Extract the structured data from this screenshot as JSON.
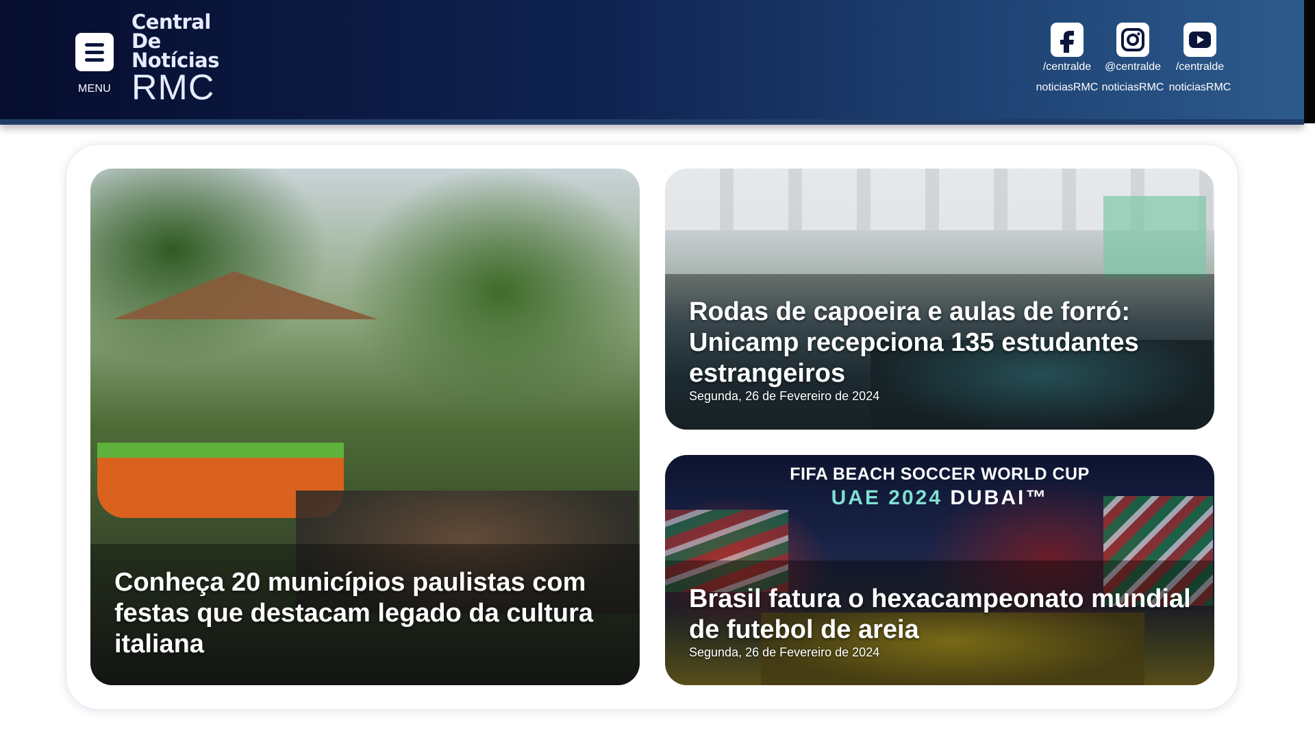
{
  "header": {
    "menu_label": "MENU",
    "logo": {
      "line1": "Central",
      "line2": "De",
      "line3": "Notícias",
      "line4": "RMC"
    },
    "social": [
      {
        "network": "facebook",
        "icon": "facebook-icon",
        "line1": "/centralde",
        "line2": "noticiasRMC"
      },
      {
        "network": "instagram",
        "icon": "instagram-icon",
        "line1": "@centralde",
        "line2": "noticiasRMC"
      },
      {
        "network": "youtube",
        "icon": "youtube-icon",
        "line1": "/centralde",
        "line2": "noticiasRMC"
      }
    ],
    "colors": {
      "gradient_start": "#060d2e",
      "gradient_end": "#2d5a8c"
    }
  },
  "stories": {
    "main": {
      "headline": "Conheça 20 municípios paulistas com festas que destacam legado da cultura italiana"
    },
    "secondary_1": {
      "headline": "Rodas de capoeira e aulas de forró: Unicamp recepciona 135 estudantes estrangeiros",
      "date": "Segunda, 26 de Fevereiro de 2024"
    },
    "secondary_2": {
      "banner_line1": "FIFA BEACH SOCCER WORLD CUP",
      "banner_line2_a": "UAE 2024",
      "banner_line2_b": "DUBAI™",
      "headline": "Brasil fatura o hexacampeonato mundial de futebol de areia",
      "date": "Segunda, 26 de Fevereiro de 2024"
    }
  }
}
